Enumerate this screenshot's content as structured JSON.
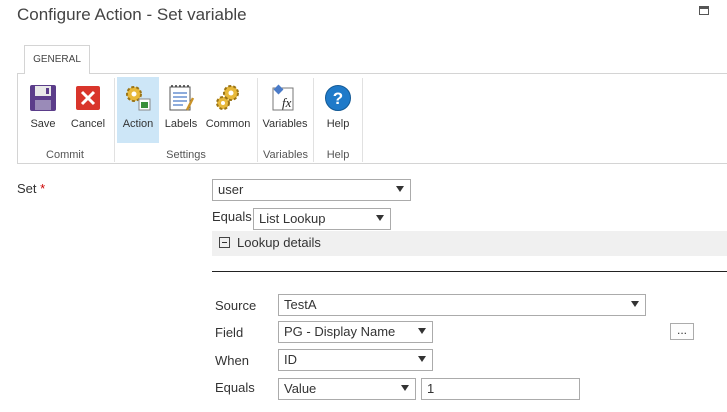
{
  "window": {
    "title": "Configure Action - Set variable"
  },
  "ribbon": {
    "tab": "GENERAL",
    "buttons": {
      "save": "Save",
      "cancel": "Cancel",
      "action": "Action",
      "labels": "Labels",
      "common": "Common",
      "variables": "Variables",
      "help": "Help"
    },
    "groups": {
      "commit": "Commit",
      "settings": "Settings",
      "variables": "Variables",
      "help": "Help"
    }
  },
  "form": {
    "set_label": "Set",
    "required_mark": "*",
    "set_value": "user",
    "equals_label": "Equals",
    "equals_value": "List Lookup",
    "lookup_details": "Lookup details",
    "source_label": "Source",
    "source_value": "TestA",
    "field_label": "Field",
    "field_value": "PG - Display Name",
    "field_button": "...",
    "when_label": "When",
    "when_value": "ID",
    "when_equals_label": "Equals",
    "when_equals_value": "Value",
    "when_equals_input": "1"
  },
  "colors": {
    "selected_button": "#cde6f7",
    "required": "#cc0000",
    "help_icon": "#1f7ac9"
  }
}
